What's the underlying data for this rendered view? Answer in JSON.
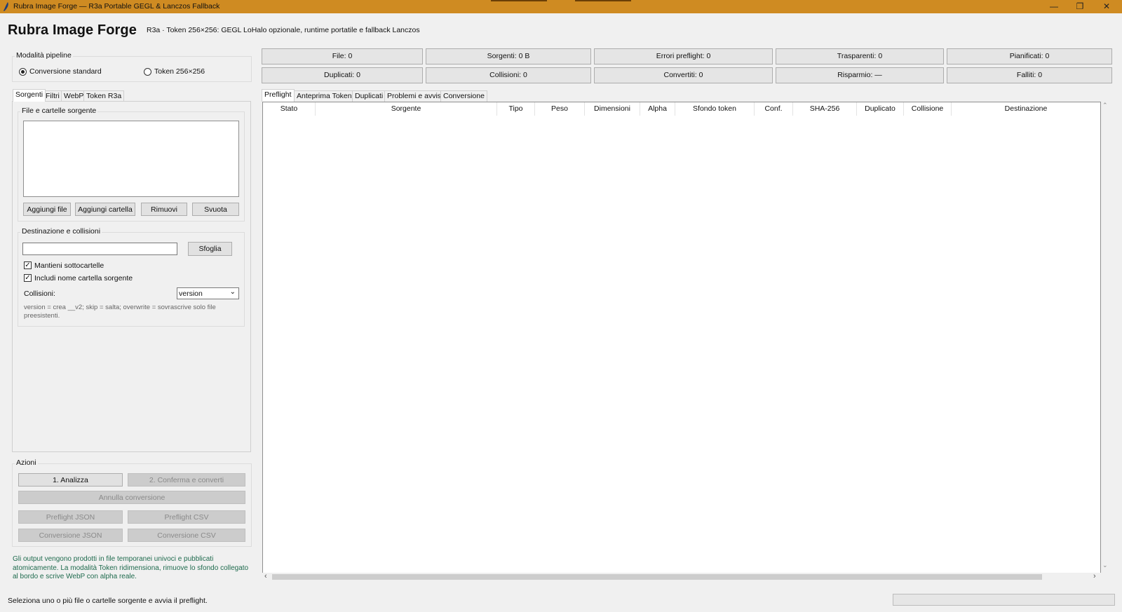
{
  "window": {
    "title": "Rubra Image Forge — R3a Portable GEGL & Lanczos Fallback",
    "accent": "#cf8b22"
  },
  "header": {
    "title": "Rubra Image Forge",
    "subtitle": "R3a · Token 256×256: GEGL LoHalo opzionale, runtime portatile e fallback Lanczos"
  },
  "pipeline": {
    "label": "Modalità pipeline",
    "options": [
      "Conversione standard",
      "Token 256×256"
    ],
    "selected": "Conversione standard"
  },
  "left_tabs": [
    "Sorgenti",
    "Filtri",
    "WebP",
    "Token R3a"
  ],
  "sources": {
    "label": "File e cartelle sorgente",
    "buttons": [
      "Aggiungi file",
      "Aggiungi cartella",
      "Rimuovi",
      "Svuota"
    ]
  },
  "destination": {
    "label": "Destinazione e collisioni",
    "path_value": "",
    "browse_label": "Sfoglia",
    "keep_subfolders": {
      "label": "Mantieni sottocartelle",
      "checked": true
    },
    "include_folder_name": {
      "label": "Includi nome cartella sorgente",
      "checked": true
    },
    "collisions_label": "Collisioni:",
    "collisions_value": "version",
    "help": "version = crea __v2; skip = salta; overwrite = sovrascrive solo file preesistenti."
  },
  "actions": {
    "label": "Azioni",
    "analyze": "1. Analizza",
    "confirm": "2. Conferma e converti",
    "cancel": "Annulla conversione",
    "preflight_json": "Preflight JSON",
    "preflight_csv": "Preflight CSV",
    "conversion_json": "Conversione JSON",
    "conversion_csv": "Conversione CSV"
  },
  "info_text": "Gli output vengono prodotti in file temporanei univoci e pubblicati atomicamente. La modalità Token ridimensiona, rimuove lo sfondo collegato al bordo e scrive WebP con alpha reale.",
  "stats_row1": [
    "File: 0",
    "Sorgenti: 0 B",
    "Errori preflight: 0",
    "Trasparenti: 0",
    "Pianificati: 0"
  ],
  "stats_row2": [
    "Duplicati: 0",
    "Collisioni: 0",
    "Convertiti: 0",
    "Risparmio: —",
    "Falliti: 0"
  ],
  "right_tabs": [
    "Preflight",
    "Anteprima Token",
    "Duplicati",
    "Problemi e avvisi",
    "Conversione"
  ],
  "table": {
    "columns": [
      "Stato",
      "Sorgente",
      "Tipo",
      "Peso",
      "Dimensioni",
      "Alpha",
      "Sfondo token",
      "Conf.",
      "SHA-256",
      "Duplicato",
      "Collisione",
      "Destinazione"
    ]
  },
  "status_bar": {
    "message": "Seleziona uno o più file o cartelle sorgente e avvia il preflight."
  }
}
